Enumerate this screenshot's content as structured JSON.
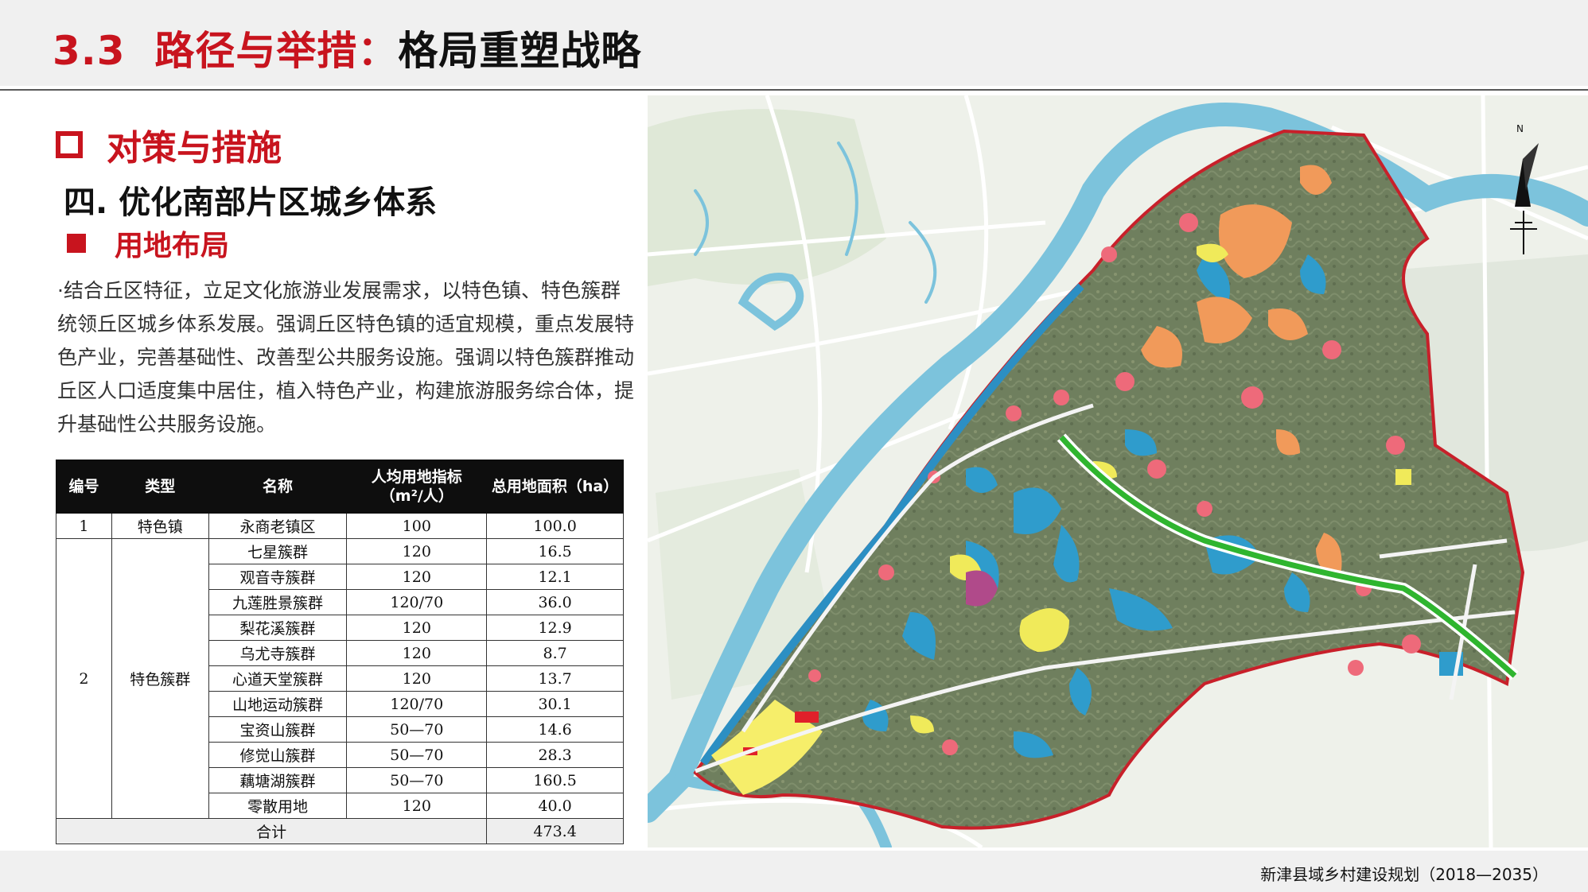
{
  "header": {
    "number": "3.3",
    "title_red": "路径与举措：",
    "title_black": "格局重塑战略"
  },
  "section1": {
    "title": "对策与措施"
  },
  "section2": {
    "title": "四.  优化南部片区城乡体系"
  },
  "section3": {
    "title": "用地布局"
  },
  "paragraph": "·结合丘区特征，立足文化旅游业发展需求，以特色镇、特色簇群统领丘区城乡体系发展。强调丘区特色镇的适宜规模，重点发展特色产业，完善基础性、改善型公共服务设施。强调以特色簇群推动丘区人口适度集中居住，植入特色产业，构建旅游服务综合体，提升基础性公共服务设施。",
  "table": {
    "headers": {
      "id": "编号",
      "type": "类型",
      "name": "名称",
      "index_line1": "人均用地指标",
      "index_line2": "（m²/人）",
      "area": "总用地面积（ha）"
    },
    "row1": {
      "id": "1",
      "type": "特色镇",
      "name": "永商老镇区",
      "index": "100",
      "area": "100.0"
    },
    "group2": {
      "id": "2",
      "type": "特色簇群"
    },
    "clusters": [
      {
        "name": "七星簇群",
        "index": "120",
        "area": "16.5"
      },
      {
        "name": "观音寺簇群",
        "index": "120",
        "area": "12.1"
      },
      {
        "name": "九莲胜景簇群",
        "index": "120/70",
        "area": "36.0"
      },
      {
        "name": "梨花溪簇群",
        "index": "120",
        "area": "12.9"
      },
      {
        "name": "乌尤寺簇群",
        "index": "120",
        "area": "8.7"
      },
      {
        "name": "心道天堂簇群",
        "index": "120",
        "area": "13.7"
      },
      {
        "name": "山地运动簇群",
        "index": "120/70",
        "area": "30.1"
      },
      {
        "name": "宝资山簇群",
        "index": "50—70",
        "area": "14.6"
      },
      {
        "name": "修觉山簇群",
        "index": "50—70",
        "area": "28.3"
      },
      {
        "name": "藕塘湖簇群",
        "index": "50—70",
        "area": "160.5"
      },
      {
        "name": "零散用地",
        "index": "120",
        "area": "40.0"
      }
    ],
    "total": {
      "label": "合计",
      "area": "473.4"
    }
  },
  "map": {
    "north_label": "N"
  },
  "footer": {
    "text": "新津县域乡村建设规划（2018—2035）"
  },
  "colors": {
    "accent_red": "#c8141e",
    "river": "#3aa0c8",
    "boundary": "#c8202a",
    "greenway": "#2fb52f",
    "terrain": "#6f7f5e"
  }
}
